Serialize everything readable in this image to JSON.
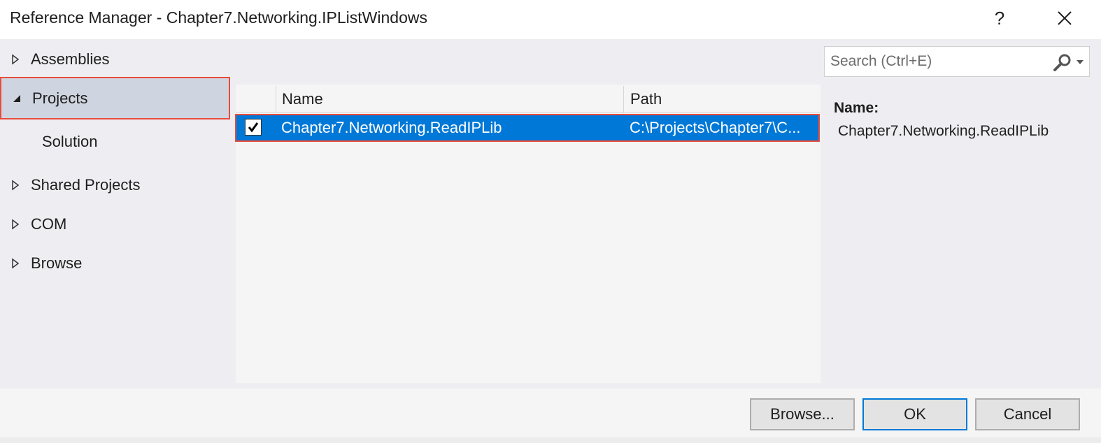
{
  "window": {
    "title": "Reference Manager - Chapter7.Networking.IPListWindows",
    "help_label": "?"
  },
  "sidebar": {
    "items": [
      {
        "label": "Assemblies",
        "expanded": false,
        "selected": false
      },
      {
        "label": "Projects",
        "expanded": true,
        "selected": true
      },
      {
        "label": "Solution",
        "child": true
      },
      {
        "label": "Shared Projects",
        "expanded": false
      },
      {
        "label": "COM",
        "expanded": false
      },
      {
        "label": "Browse",
        "expanded": false
      }
    ]
  },
  "list": {
    "columns": [
      "Name",
      "Path"
    ],
    "rows": [
      {
        "checked": true,
        "name": "Chapter7.Networking.ReadIPLib",
        "path": "C:\\Projects\\Chapter7\\C..."
      }
    ]
  },
  "search": {
    "placeholder": "Search (Ctrl+E)"
  },
  "details": {
    "name_label": "Name:",
    "name_value": "Chapter7.Networking.ReadIPLib"
  },
  "footer": {
    "browse_label": "Browse...",
    "ok_label": "OK",
    "cancel_label": "Cancel"
  },
  "colors": {
    "accent": "#0078d7",
    "highlight_border": "#e74c3c",
    "selected_nav_bg": "#cfd5e0"
  },
  "icons": [
    "close-icon",
    "collapsed-triangle-icon",
    "expanded-triangle-icon",
    "checkmark-icon",
    "search-icon",
    "chevron-down-icon"
  ]
}
